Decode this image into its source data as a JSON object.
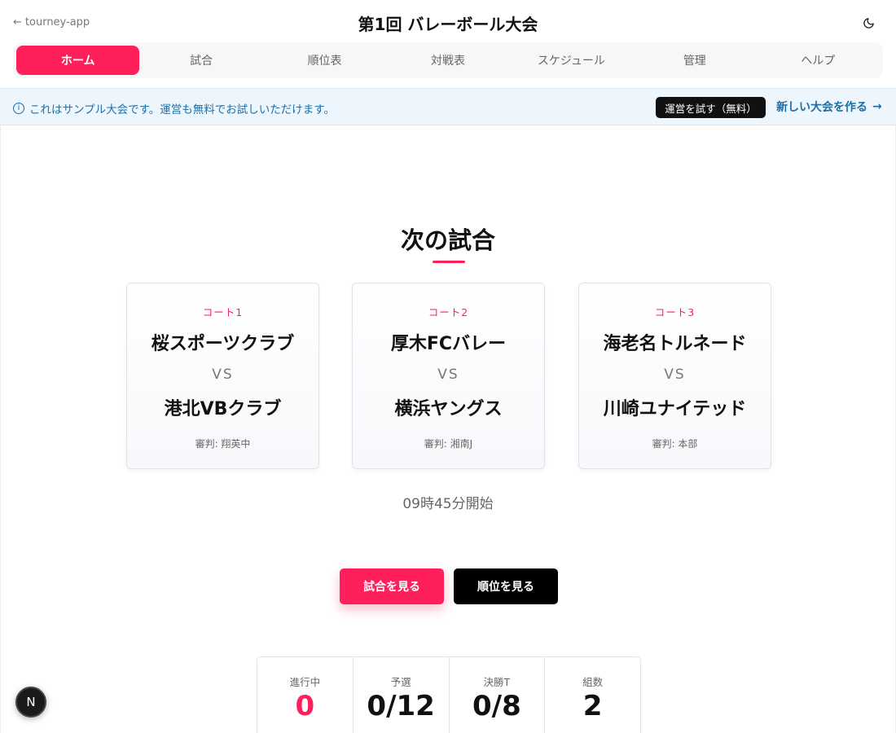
{
  "header": {
    "back_label": "tourney-app",
    "title": "第1回 バレーボール大会",
    "theme_icon": "moon-icon"
  },
  "nav": {
    "tabs": [
      {
        "label": "ホーム",
        "active": true
      },
      {
        "label": "試合",
        "active": false
      },
      {
        "label": "順位表",
        "active": false
      },
      {
        "label": "対戦表",
        "active": false
      },
      {
        "label": "スケジュール",
        "active": false
      },
      {
        "label": "管理",
        "active": false
      },
      {
        "label": "ヘルプ",
        "active": false
      }
    ]
  },
  "banner": {
    "info_icon": "ⓘ",
    "text": "これはサンプル大会です。運営も無料でお試しいただけます。",
    "try_button": "運営を試す（無料）",
    "new_link": "新しい大会を作る",
    "new_link_arrow": "→"
  },
  "next_matches": {
    "title": "次の試合",
    "vs_label": "VS",
    "cards": [
      {
        "court": "コート1",
        "team1": "桜スポーツクラブ",
        "team2": "港北VBクラブ",
        "referee": "審判: 翔英中"
      },
      {
        "court": "コート2",
        "team1": "厚木FCバレー",
        "team2": "横浜ヤングス",
        "referee": "審判: 湘南J"
      },
      {
        "court": "コート3",
        "team1": "海老名トルネード",
        "team2": "川崎ユナイテッド",
        "referee": "審判: 本部"
      }
    ],
    "start_time": "09時45分開始"
  },
  "actions": {
    "view_matches": "試合を見る",
    "view_standings": "順位を見る"
  },
  "stats": [
    {
      "label": "進行中",
      "value": "0",
      "accent": true
    },
    {
      "label": "予選",
      "value": "0/12",
      "accent": false
    },
    {
      "label": "決勝T",
      "value": "0/8",
      "accent": false
    },
    {
      "label": "組数",
      "value": "2",
      "accent": false
    }
  ],
  "dev_badge": "N",
  "colors": {
    "accent": "#ff1f5a",
    "info": "#1b6fa8",
    "banner_bg": "#eef6fd"
  }
}
